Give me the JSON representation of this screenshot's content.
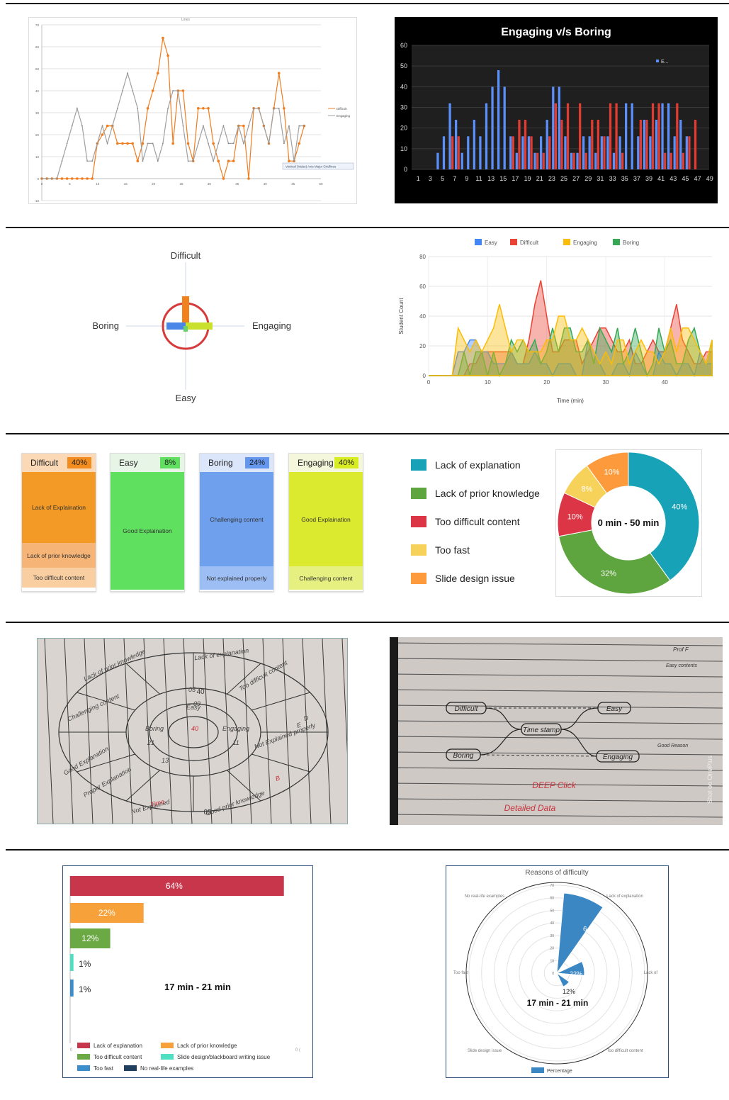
{
  "chart_data": [
    {
      "type": "line",
      "title": "Lines",
      "ylim": [
        -10,
        70
      ],
      "xlim": [
        0,
        50
      ],
      "yticks": [
        "-10",
        "0",
        "10",
        "20",
        "30",
        "40",
        "50",
        "60",
        "70"
      ],
      "xticks": [
        "0",
        "5",
        "10",
        "15",
        "20",
        "25",
        "30",
        "35",
        "40",
        "45",
        "50"
      ],
      "legend": "right",
      "annotation": "Vertical (Value) Axis Major Gridlines",
      "series": [
        {
          "name": "Difficult",
          "color": "#f07c1e",
          "values": [
            0,
            0,
            0,
            0,
            0,
            0,
            0,
            0,
            0,
            0,
            0,
            16,
            20,
            24,
            24,
            16,
            16,
            16,
            16,
            8,
            16,
            32,
            40,
            48,
            64,
            56,
            16,
            40,
            40,
            16,
            8,
            32,
            32,
            32,
            16,
            8,
            0,
            8,
            8,
            24,
            24,
            0,
            32,
            32,
            24,
            16,
            32,
            48,
            32,
            8,
            8,
            16,
            24
          ]
        },
        {
          "name": "Engaging",
          "color": "#a0a0a0",
          "values": [
            0,
            0,
            0,
            0,
            8,
            16,
            24,
            32,
            24,
            8,
            8,
            16,
            24,
            16,
            24,
            32,
            40,
            48,
            40,
            32,
            8,
            16,
            16,
            8,
            16,
            32,
            40,
            40,
            24,
            8,
            8,
            16,
            24,
            16,
            8,
            16,
            24,
            16,
            16,
            24,
            16,
            24,
            32,
            32,
            24,
            16,
            32,
            32,
            16,
            24,
            8,
            24,
            24
          ]
        }
      ]
    },
    {
      "type": "bar",
      "title": "Engaging v/s Boring",
      "legend_label": "E...",
      "ylim": [
        0,
        60
      ],
      "yticks": [
        "0",
        "10",
        "20",
        "30",
        "40",
        "50",
        "60"
      ],
      "xticks": [
        "1",
        "3",
        "5",
        "7",
        "9",
        "11",
        "13",
        "15",
        "17",
        "19",
        "21",
        "23",
        "25",
        "27",
        "29",
        "31",
        "33",
        "35",
        "37",
        "39",
        "41",
        "43",
        "45",
        "47",
        "49"
      ],
      "series": [
        {
          "name": "Engaging",
          "color": "#5b8ff9",
          "values": [
            0,
            0,
            0,
            0,
            8,
            16,
            32,
            24,
            8,
            16,
            24,
            16,
            32,
            40,
            48,
            40,
            16,
            8,
            16,
            16,
            8,
            16,
            24,
            40,
            40,
            16,
            8,
            8,
            16,
            16,
            8,
            16,
            16,
            8,
            16,
            32,
            32,
            16,
            24,
            16,
            24,
            32,
            32,
            16,
            24,
            16
          ]
        },
        {
          "name": "Boring",
          "color": "#e03c31",
          "values": [
            0,
            0,
            0,
            0,
            0,
            0,
            16,
            16,
            0,
            0,
            0,
            0,
            0,
            0,
            0,
            0,
            16,
            24,
            24,
            16,
            8,
            8,
            16,
            32,
            24,
            32,
            8,
            32,
            8,
            24,
            24,
            16,
            32,
            32,
            8,
            0,
            0,
            24,
            24,
            32,
            32,
            8,
            8,
            32,
            8,
            16,
            24
          ]
        }
      ]
    },
    {
      "type": "quadrant",
      "axes": {
        "top": "Difficult",
        "bottom": "Easy",
        "left": "Boring",
        "right": "Engaging"
      }
    },
    {
      "type": "area",
      "legend": [
        "Easy",
        "Difficult",
        "Engaging",
        "Boring"
      ],
      "colors": [
        "#4285f4",
        "#ea4335",
        "#fbbc04",
        "#34a853"
      ],
      "ylabel": "Student Count",
      "xlabel": "Time (min)",
      "ylim": [
        0,
        80
      ],
      "xlim": [
        0,
        48
      ],
      "yticks": [
        "0",
        "20",
        "40",
        "60",
        "80"
      ],
      "xticks": [
        "0",
        "10",
        "20",
        "30",
        "40"
      ],
      "x": [
        0,
        1,
        2,
        3,
        4,
        5,
        6,
        7,
        8,
        9,
        10,
        11,
        12,
        13,
        14,
        15,
        16,
        17,
        18,
        19,
        20,
        21,
        22,
        23,
        24,
        25,
        26,
        27,
        28,
        29,
        30,
        31,
        32,
        33,
        34,
        35,
        36,
        37,
        38,
        39,
        40,
        41,
        42,
        43,
        44,
        45,
        46,
        47,
        48
      ],
      "series": [
        {
          "name": "Easy",
          "values": [
            0,
            0,
            0,
            0,
            0,
            16,
            16,
            24,
            24,
            16,
            16,
            8,
            8,
            8,
            16,
            8,
            8,
            8,
            16,
            8,
            8,
            0,
            8,
            8,
            8,
            0,
            0,
            24,
            16,
            8,
            0,
            0,
            8,
            8,
            0,
            16,
            8,
            0,
            0,
            16,
            8,
            8,
            0,
            8,
            8,
            0,
            16,
            8,
            8
          ]
        },
        {
          "name": "Difficult",
          "values": [
            0,
            0,
            0,
            0,
            0,
            0,
            0,
            8,
            8,
            16,
            16,
            16,
            16,
            16,
            16,
            8,
            8,
            24,
            48,
            64,
            40,
            16,
            16,
            24,
            24,
            24,
            8,
            16,
            24,
            32,
            32,
            24,
            16,
            16,
            24,
            8,
            8,
            16,
            24,
            16,
            16,
            32,
            48,
            24,
            16,
            8,
            8,
            16,
            16
          ]
        },
        {
          "name": "Engaging",
          "values": [
            0,
            0,
            0,
            0,
            0,
            32,
            24,
            16,
            24,
            16,
            24,
            32,
            48,
            32,
            16,
            24,
            24,
            16,
            16,
            16,
            24,
            24,
            40,
            40,
            24,
            24,
            32,
            24,
            16,
            8,
            16,
            8,
            24,
            24,
            8,
            16,
            24,
            16,
            16,
            8,
            16,
            32,
            16,
            32,
            32,
            24,
            16,
            8,
            24
          ]
        },
        {
          "name": "Boring",
          "values": [
            0,
            0,
            0,
            0,
            0,
            0,
            16,
            0,
            16,
            16,
            0,
            16,
            0,
            8,
            24,
            16,
            24,
            16,
            24,
            8,
            16,
            32,
            16,
            32,
            32,
            16,
            16,
            24,
            8,
            32,
            24,
            16,
            32,
            8,
            16,
            32,
            16,
            0,
            8,
            32,
            16,
            24,
            8,
            8,
            24,
            32,
            16,
            8,
            24
          ]
        }
      ]
    },
    {
      "type": "table",
      "cards": [
        {
          "label": "Difficult",
          "pct": "40%",
          "segments": [
            "Lack of Explaination",
            "Lack of prior knowledge",
            "Too difficult content"
          ]
        },
        {
          "label": "Easy",
          "pct": "8%",
          "segments": [
            "Good Explaination"
          ]
        },
        {
          "label": "Boring",
          "pct": "24%",
          "segments": [
            "Challenging content",
            "Not explained properly"
          ]
        },
        {
          "label": "Engaging",
          "pct": "40%",
          "segments": [
            "Good Explaination",
            "Challenging content"
          ]
        }
      ]
    },
    {
      "type": "pie",
      "center_label": "0 min - 50 min",
      "labels": [
        "Lack of explanation",
        "Lack of prior knowledge",
        "Too difficult content",
        "Too fast",
        "Slide design issue"
      ],
      "values": [
        40,
        32,
        10,
        8,
        10
      ],
      "value_labels": [
        "40%",
        "32%",
        "10%",
        "8%",
        "10%"
      ],
      "colors": [
        "#17a2b8",
        "#5fa53f",
        "#dc3545",
        "#f6d25a",
        "#fd9a3c"
      ]
    },
    {
      "type": "bar",
      "orientation": "horizontal",
      "center_label": "17 min - 21 min",
      "labels": [
        "Lack of explanation",
        "Lack of prior knowledge",
        "Too difficult content",
        "Slide design/blackboard writing issue",
        "Too fast",
        "No real-life examples"
      ],
      "values": [
        64,
        22,
        12,
        1,
        1,
        0
      ],
      "value_labels": [
        "64%",
        "22%",
        "12%",
        "1%",
        "1%",
        ""
      ],
      "colors": [
        "#c8364b",
        "#f7a13a",
        "#6aa943",
        "#4fe0c3",
        "#3b8ec9",
        "#1f3f5f"
      ],
      "xticks": [
        "0",
        "",
        "0 ("
      ]
    },
    {
      "type": "polar",
      "title": "Reasons of difficulty",
      "center_label": "17 min - 21 min",
      "legend": [
        "Percentage"
      ],
      "categories": [
        "Lack of explanation",
        "Lack of",
        "Too difficult content",
        "Slide design issue",
        "Too fast",
        "No real-life examples"
      ],
      "values": [
        64,
        22,
        12,
        0,
        0,
        0
      ],
      "value_labels": [
        "64%",
        "22%",
        "12%"
      ],
      "rticks": [
        "0",
        "10",
        "20",
        "30",
        "40",
        "50",
        "60",
        "70"
      ]
    }
  ],
  "sketches": {
    "left": {
      "words": [
        "Lack of prior knowledge",
        "Lack of explanation",
        "Too difficult content",
        "Challenging content",
        "Good Explanation",
        "Proper Explanation",
        "Not Explained",
        "Not Explained properly",
        "Good prior knowledge",
        "D",
        "E",
        "B",
        "Time",
        "Easy",
        "Boring",
        "Engaging",
        "40",
        "21",
        "11",
        "13",
        "05",
        "09",
        "02",
        "06"
      ]
    },
    "right": {
      "words": [
        "Difficult",
        "Easy",
        "Boring",
        "Engaging",
        "Time stamp",
        "DEEP Click",
        "Detailed Data",
        "Prof F",
        "Easy contents",
        "Good Reason",
        "Shot on OnePlus"
      ]
    }
  }
}
